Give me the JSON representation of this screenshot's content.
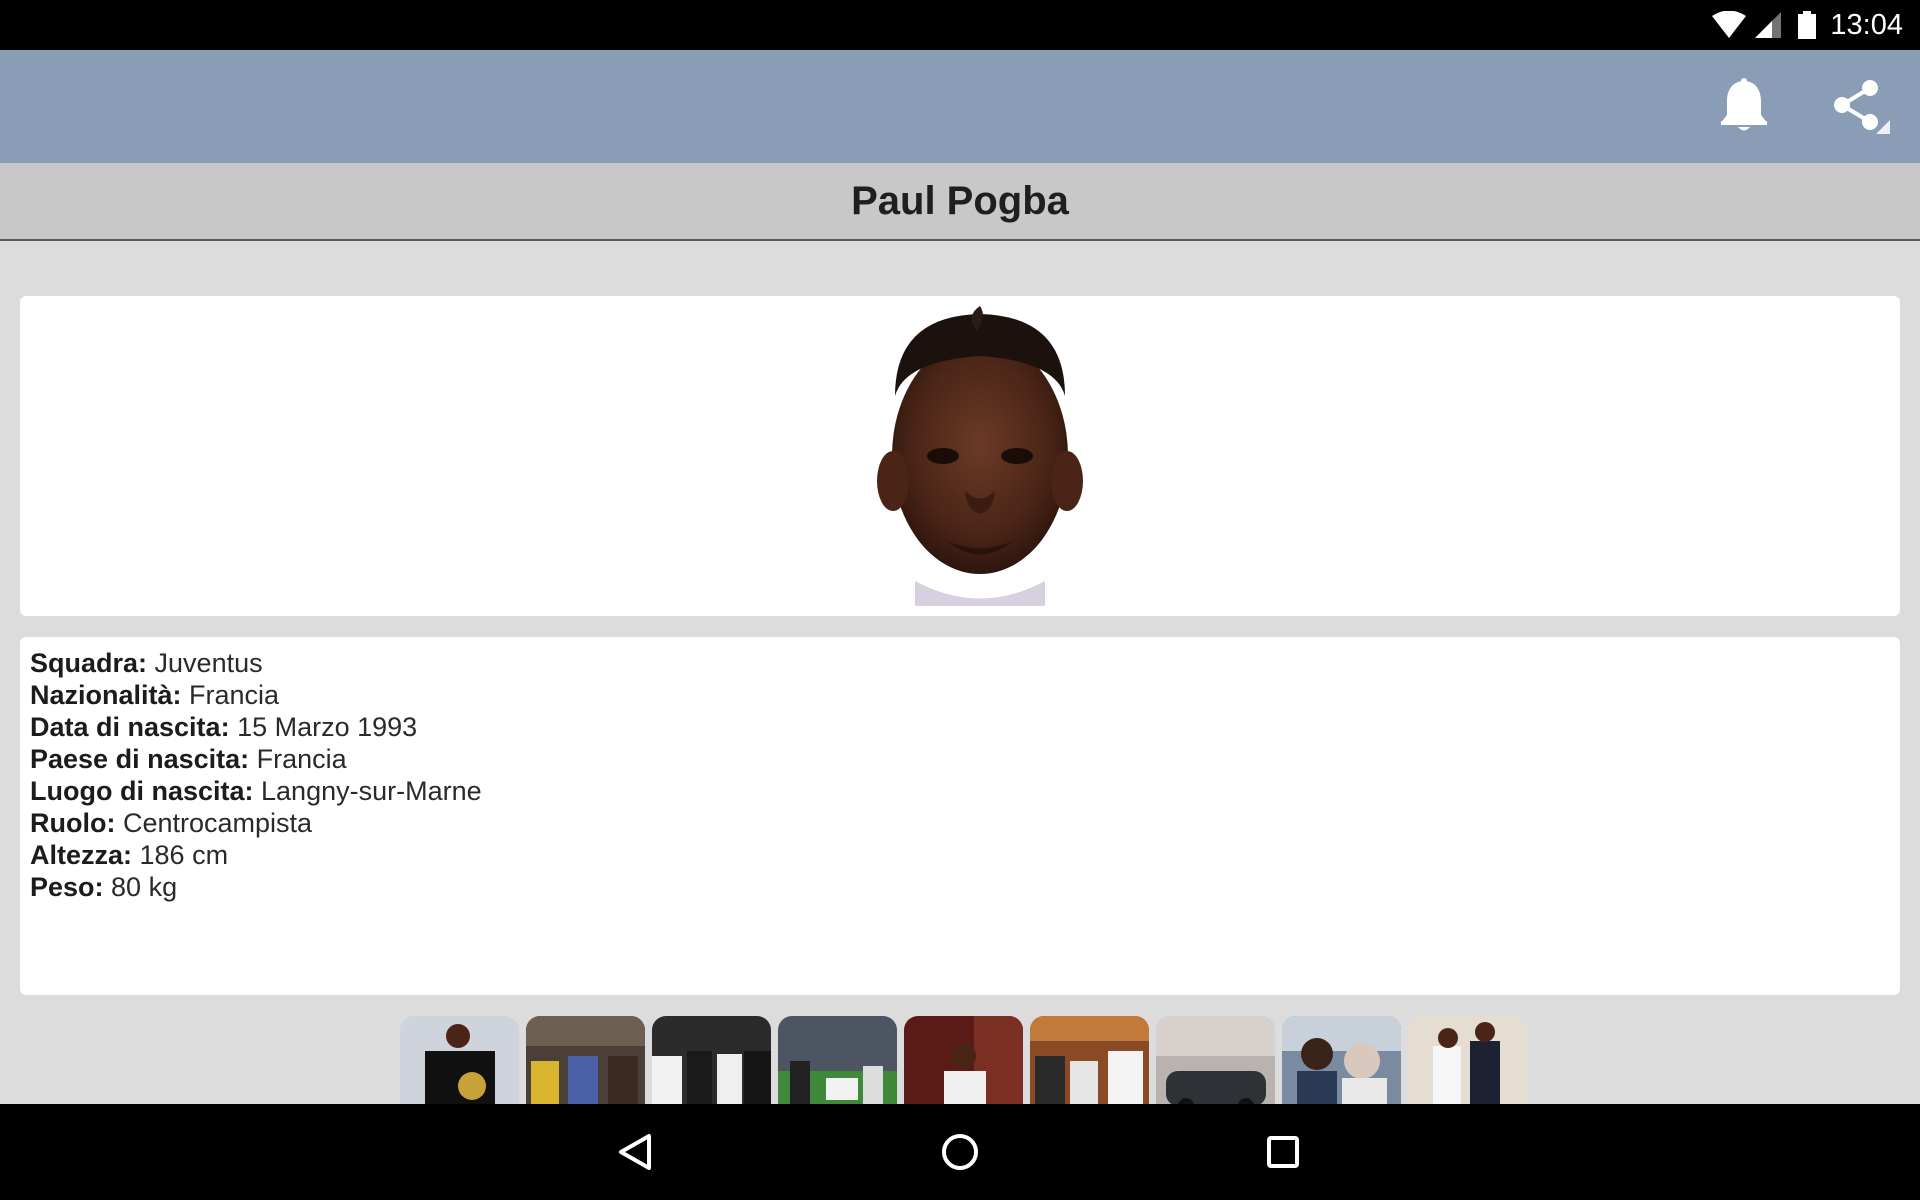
{
  "status_bar": {
    "time": "13:04"
  },
  "player": {
    "name": "Paul Pogba",
    "details": [
      {
        "label": "Squadra:",
        "value": " Juventus"
      },
      {
        "label": "Nazionalità:",
        "value": " Francia"
      },
      {
        "label": "Data di nascita:",
        "value": " 15 Marzo 1993"
      },
      {
        "label": "Paese di nascita:",
        "value": " Francia"
      },
      {
        "label": "Luogo di nascita:",
        "value": " Langny-sur-Marne"
      },
      {
        "label": "Ruolo:",
        "value": " Centrocampista"
      },
      {
        "label": "Altezza:",
        "value": " 186 cm"
      },
      {
        "label": "Peso:",
        "value": " 80 kg"
      }
    ]
  },
  "colors": {
    "action_bar": "#8a9db6",
    "title_bar": "#c8c8c8",
    "background": "#dcdcdc"
  },
  "icons": {
    "notify": "bell-icon",
    "share": "share-icon"
  }
}
